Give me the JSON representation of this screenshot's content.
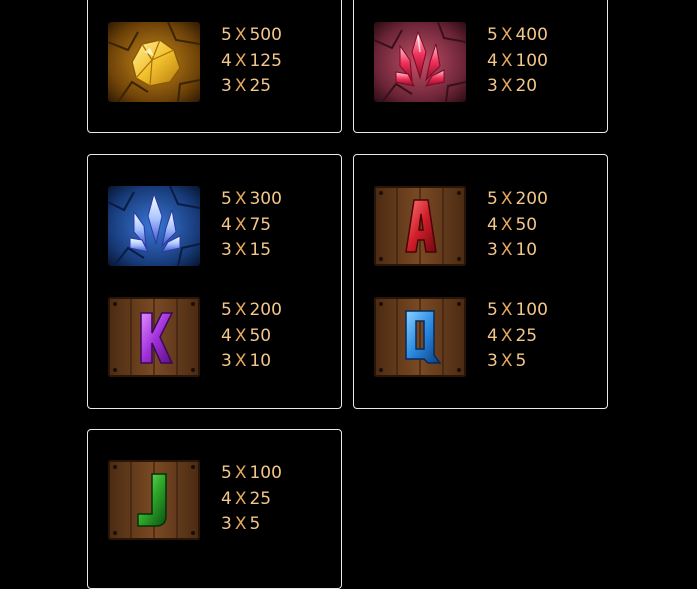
{
  "colors": {
    "background": "#000000",
    "panel_border": "#e9e9e9",
    "payout_text": "#f3c68a",
    "multiplier_x": "#e6a85e"
  },
  "panels": [
    {
      "symbols": [
        {
          "icon": "gold-nugget-icon",
          "pays": [
            {
              "count": "5",
              "mult": "500"
            },
            {
              "count": "4",
              "mult": "125"
            },
            {
              "count": "3",
              "mult": "25"
            }
          ]
        }
      ]
    },
    {
      "symbols": [
        {
          "icon": "red-crystal-icon",
          "pays": [
            {
              "count": "5",
              "mult": "400"
            },
            {
              "count": "4",
              "mult": "100"
            },
            {
              "count": "3",
              "mult": "20"
            }
          ]
        }
      ]
    },
    {
      "symbols": [
        {
          "icon": "blue-crystal-icon",
          "pays": [
            {
              "count": "5",
              "mult": "300"
            },
            {
              "count": "4",
              "mult": "75"
            },
            {
              "count": "3",
              "mult": "15"
            }
          ]
        },
        {
          "icon": "letter-k-icon",
          "letter": "K",
          "pays": [
            {
              "count": "5",
              "mult": "200"
            },
            {
              "count": "4",
              "mult": "50"
            },
            {
              "count": "3",
              "mult": "10"
            }
          ]
        }
      ]
    },
    {
      "symbols": [
        {
          "icon": "letter-a-icon",
          "letter": "A",
          "pays": [
            {
              "count": "5",
              "mult": "200"
            },
            {
              "count": "4",
              "mult": "50"
            },
            {
              "count": "3",
              "mult": "10"
            }
          ]
        },
        {
          "icon": "letter-q-icon",
          "letter": "Q",
          "pays": [
            {
              "count": "5",
              "mult": "100"
            },
            {
              "count": "4",
              "mult": "25"
            },
            {
              "count": "3",
              "mult": "5"
            }
          ]
        }
      ]
    },
    {
      "symbols": [
        {
          "icon": "letter-j-icon",
          "letter": "J",
          "pays": [
            {
              "count": "5",
              "mult": "100"
            },
            {
              "count": "4",
              "mult": "25"
            },
            {
              "count": "3",
              "mult": "5"
            }
          ]
        }
      ]
    }
  ]
}
